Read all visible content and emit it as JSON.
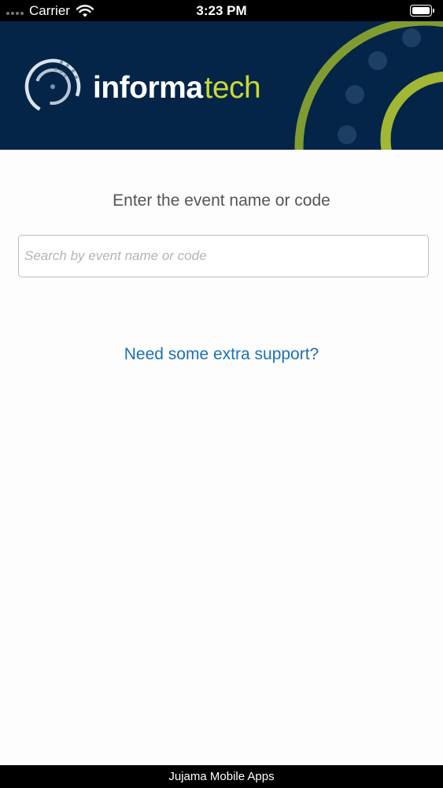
{
  "status_bar": {
    "carrier": "Carrier",
    "time": "3:23 PM",
    "signal_icon": "signal-dots-icon",
    "wifi_icon": "wifi-icon",
    "battery_icon": "battery-icon"
  },
  "header": {
    "logo_icon": "informa-tech-logo",
    "wordmark_primary": "informa",
    "wordmark_secondary": "tech"
  },
  "main": {
    "prompt": "Enter the event name or code",
    "search": {
      "placeholder": "Search by event name or code",
      "value": ""
    },
    "support_link": "Need some extra support?"
  },
  "footer": {
    "text": "Jujama Mobile Apps"
  },
  "colors": {
    "banner_background": "#042548",
    "accent_green": "#c9d934",
    "link_blue": "#1c70b6",
    "status_bar": "#000000"
  }
}
